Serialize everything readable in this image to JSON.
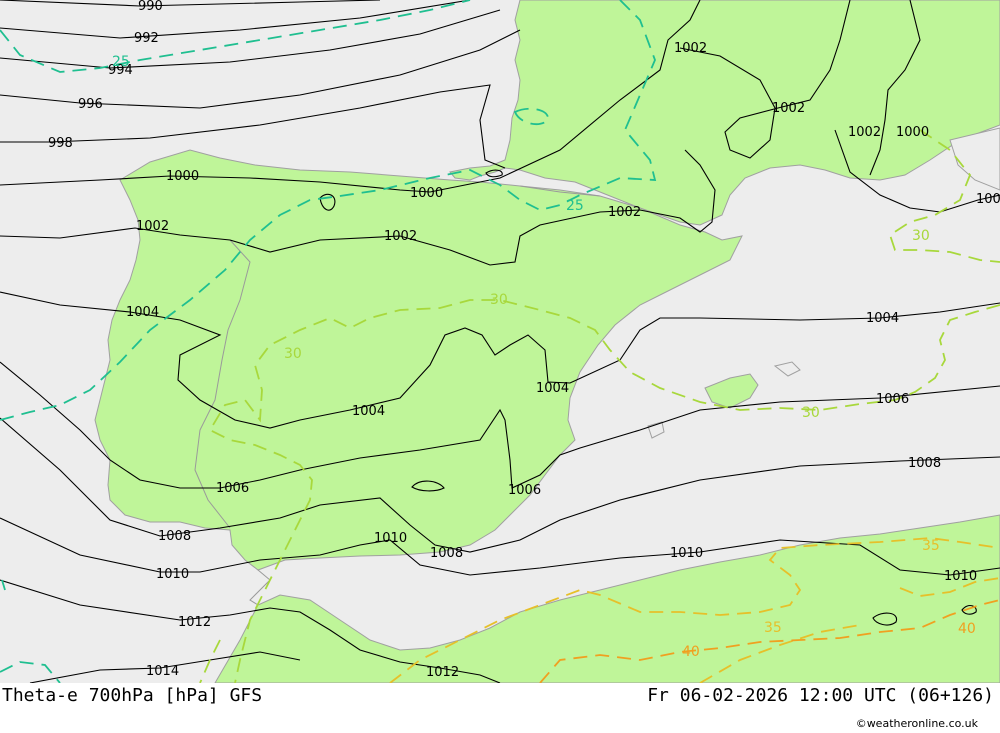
{
  "map": {
    "colors": {
      "sea": "#ededed",
      "land": "#bff599",
      "coast": "#a0a0a0",
      "isobar": "#000000",
      "theta_25": "#1fbf90",
      "theta_30": "#a8d83c",
      "theta_35": "#e6c02a",
      "theta_40": "#f0a020"
    },
    "isobar_labels": [
      {
        "id": "p990",
        "text": "990"
      },
      {
        "id": "p992",
        "text": "992"
      },
      {
        "id": "p994",
        "text": "994"
      },
      {
        "id": "p996",
        "text": "996"
      },
      {
        "id": "p998",
        "text": "998"
      },
      {
        "id": "p1000a",
        "text": "1000"
      },
      {
        "id": "p1000b",
        "text": "1000"
      },
      {
        "id": "p1000c",
        "text": "1000"
      },
      {
        "id": "p1002a",
        "text": "1002"
      },
      {
        "id": "p1002b",
        "text": "1002"
      },
      {
        "id": "p1002c",
        "text": "1002"
      },
      {
        "id": "p1002d",
        "text": "1002"
      },
      {
        "id": "p1002e",
        "text": "1002"
      },
      {
        "id": "p1002f",
        "text": "1002"
      },
      {
        "id": "p1004a",
        "text": "1004"
      },
      {
        "id": "p1004b",
        "text": "1004"
      },
      {
        "id": "p1004c",
        "text": "1004"
      },
      {
        "id": "p1004d",
        "text": "1004"
      },
      {
        "id": "p1006a",
        "text": "1006"
      },
      {
        "id": "p1006b",
        "text": "1006"
      },
      {
        "id": "p1006c",
        "text": "1006"
      },
      {
        "id": "p1008a",
        "text": "1008"
      },
      {
        "id": "p1008b",
        "text": "1008"
      },
      {
        "id": "p1008c",
        "text": "1008"
      },
      {
        "id": "p1010a",
        "text": "1010"
      },
      {
        "id": "p1010b",
        "text": "1010"
      },
      {
        "id": "p1010c",
        "text": "1010"
      },
      {
        "id": "p1010d",
        "text": "1010"
      },
      {
        "id": "p1012a",
        "text": "1012"
      },
      {
        "id": "p1012b",
        "text": "1012"
      },
      {
        "id": "p1014",
        "text": "1014"
      },
      {
        "id": "p100x",
        "text": "100"
      }
    ],
    "theta_labels": [
      {
        "id": "t25a",
        "text": "25"
      },
      {
        "id": "t25b",
        "text": "25"
      },
      {
        "id": "t30a",
        "text": "30"
      },
      {
        "id": "t30b",
        "text": "30"
      },
      {
        "id": "t30c",
        "text": "30"
      },
      {
        "id": "t30d",
        "text": "30"
      },
      {
        "id": "t35a",
        "text": "35"
      },
      {
        "id": "t35b",
        "text": "35"
      },
      {
        "id": "t40a",
        "text": "40"
      },
      {
        "id": "t40b",
        "text": "40"
      }
    ]
  },
  "footer": {
    "title": "Theta-e 700hPa [hPa] GFS",
    "datetime": "Fr 06-02-2026 12:00 UTC (06+126)",
    "credit": "©weatheronline.co.uk"
  }
}
